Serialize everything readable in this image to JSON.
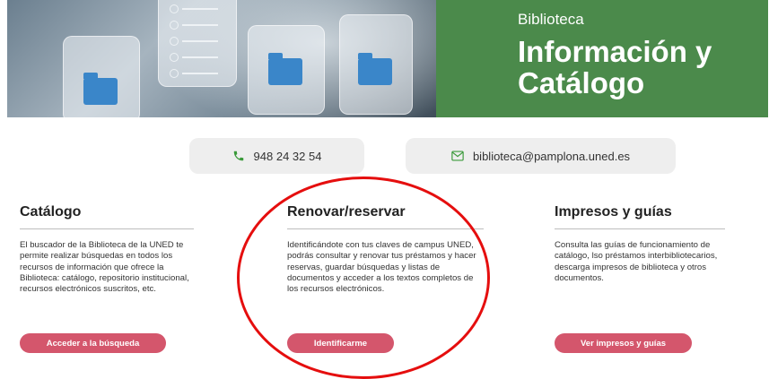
{
  "banner": {
    "kicker": "Biblioteca",
    "title": "Información y Catálogo",
    "green_color": "#4b8a4b"
  },
  "contact": {
    "phone": "948 24 32 54",
    "phone_icon": "phone-icon",
    "email": "biblioteca@pamplona.uned.es",
    "email_icon": "mail-icon",
    "icon_color": "#3a9a3a"
  },
  "columns": [
    {
      "title": "Catálogo",
      "text": "El buscador de la Biblioteca de la UNED te permite realizar búsquedas en todos los recursos de información que ofrece la Biblioteca: catálogo, repositorio institucional, recursos electrónicos suscritos, etc.",
      "button": "Acceder a la búsqueda"
    },
    {
      "title": "Renovar/reservar",
      "text": "Identificándote con tus claves de campus UNED, podrás consultar y renovar tus préstamos y hacer reservas, guardar búsquedas y listas de documentos y acceder a los textos completos de los recursos electrónicos.",
      "button": "Identificarme"
    },
    {
      "title": "Impresos y guías",
      "text": "Consulta las guías de funcionamiento de catálogo, lso préstamos interbibliotecarios, descarga impresos de biblioteca y otros documentos.",
      "button": "Ver impresos y guías"
    }
  ],
  "button_color": "#d4566c",
  "annotation_color": "#e50e0e"
}
